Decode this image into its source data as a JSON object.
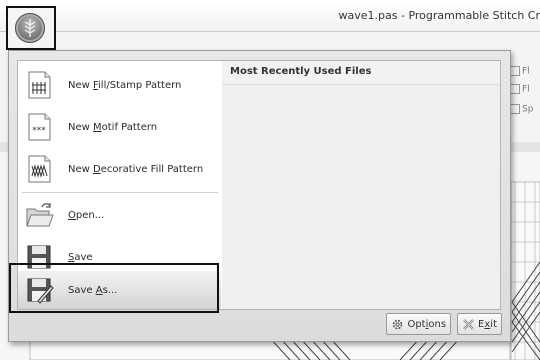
{
  "window": {
    "title": "wave1.pas - Programmable Stitch Cr"
  },
  "background_ribbon": {
    "items": [
      "Fl",
      "Fl",
      "Sp"
    ]
  },
  "app_menu": {
    "commands": [
      {
        "pre": "New ",
        "u": "F",
        "post": "ill/Stamp Pattern",
        "icon": "fill-stamp-pattern-icon"
      },
      {
        "pre": "New ",
        "u": "M",
        "post": "otif Pattern",
        "icon": "motif-pattern-icon"
      },
      {
        "pre": "New ",
        "u": "D",
        "post": "ecorative Fill Pattern",
        "icon": "decorative-fill-pattern-icon"
      },
      {
        "pre": "",
        "u": "O",
        "post": "pen...",
        "icon": "open-folder-icon"
      },
      {
        "pre": "",
        "u": "S",
        "post": "ave",
        "icon": "save-disk-icon"
      },
      {
        "pre": "Save ",
        "u": "A",
        "post": "s...",
        "icon": "save-as-icon"
      }
    ],
    "recent_files_header": "Most Recently Used Files",
    "options_button": {
      "pre": "Opt",
      "u": "i",
      "post": "ons"
    },
    "exit_button": {
      "pre": "E",
      "u": "x",
      "post": "it"
    }
  },
  "colors": {
    "highlight_border": "#111111",
    "menu_background": "#e2e2e2",
    "panel_background": "#efefef"
  }
}
